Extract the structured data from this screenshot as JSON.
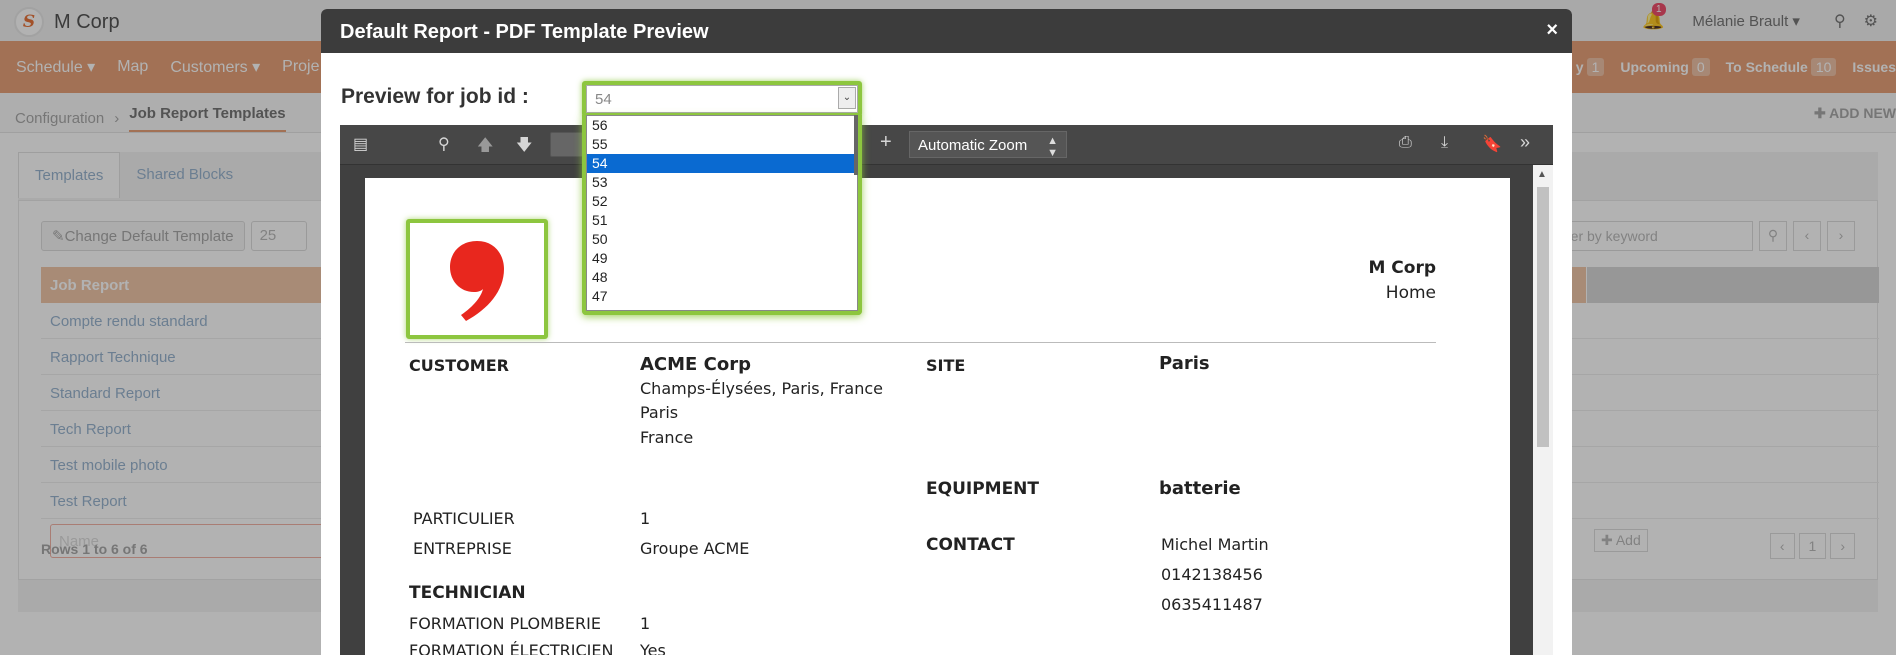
{
  "app": {
    "brand": "M Corp",
    "notification_count": "1",
    "user": "Mélanie Brault ▾"
  },
  "nav": {
    "items": [
      "Schedule ▾",
      "Map",
      "Customers ▾",
      "Proje"
    ],
    "counts": [
      {
        "label": "y",
        "count": "1"
      },
      {
        "label": "Upcoming",
        "count": "0"
      },
      {
        "label": "To Schedule",
        "count": "10"
      },
      {
        "label": "Issues",
        "count": ""
      }
    ]
  },
  "breadcrumb": {
    "root": "Configuration",
    "current": "Job Report Templates",
    "add_new": "✚ ADD NEW"
  },
  "templates": {
    "tabs": [
      "Templates",
      "Shared Blocks"
    ],
    "change_default": "Change Default Template",
    "page_size": "25",
    "filter_placeholder": "Filter by keyword",
    "header": "Job Report",
    "rows": [
      "Compte rendu standard",
      "Rapport Technique",
      "Standard Report",
      "Tech Report",
      "Test mobile photo",
      "Test Report"
    ],
    "name_placeholder": "Name",
    "add_label": "✚ Add",
    "rows_info": "Rows 1 to 6 of 6",
    "page_number": "1"
  },
  "modal": {
    "title": "Default Report - PDF Template Preview",
    "close": "×",
    "preview_label": "Preview for job id :",
    "selected_job_id": "54",
    "job_id_options": [
      "56",
      "55",
      "54",
      "53",
      "52",
      "51",
      "50",
      "49",
      "48",
      "47"
    ],
    "zoom": "Automatic Zoom"
  },
  "report": {
    "company_name": "M Corp",
    "company_line2": "Home",
    "customer_label": "CUSTOMER",
    "customer_name": "ACME Corp",
    "customer_address": [
      "Champs-Élysées, Paris, France",
      "Paris",
      "France"
    ],
    "site_label": "SITE",
    "site_value": "Paris",
    "equipment_label": "EQUIPMENT",
    "equipment_value": "batterie",
    "particulier_label": "PARTICULIER",
    "particulier_value": "1",
    "entreprise_label": "ENTREPRISE",
    "entreprise_value": "Groupe ACME",
    "contact_label": "CONTACT",
    "contact_name": "Michel Martin",
    "contact_phone1": "0142138456",
    "contact_phone2": "0635411487",
    "technician_label": "TECHNICIAN",
    "formation_plomberie_label": "FORMATION PLOMBERIE",
    "formation_plomberie_value": "1",
    "formation_electricien_label": "FORMATION ÉLECTRICIEN",
    "formation_electricien_value": "Yes"
  },
  "colors": {
    "highlight": "#8dc63f",
    "accent": "#e8a37a",
    "selected_option": "#0a6ad1",
    "logo_red": "#e8271e"
  }
}
